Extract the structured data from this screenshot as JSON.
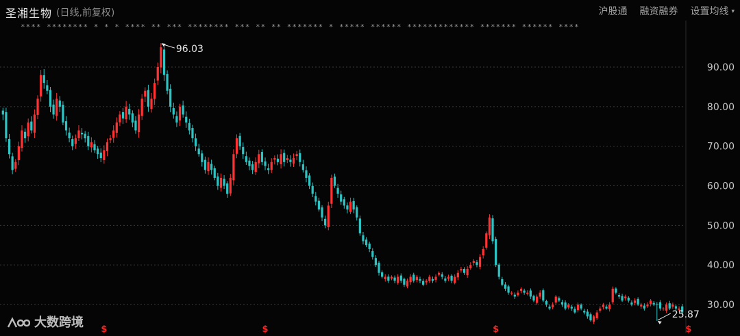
{
  "header": {
    "title": "圣湘生物",
    "subtitle": "(日线,前复权)",
    "menu": [
      "沪股通",
      "融资融券",
      "设置均线"
    ],
    "caret": "▾",
    "ma_row": "**** ******** * * * **** **  *** ******** *** **  ** ******* *  ***** ****** ************* ******* ****** ****"
  },
  "watermark": {
    "text": "大数跨境",
    "logo": "logo-icon"
  },
  "colors": {
    "up": "#ff3333",
    "down": "#2fc4c4",
    "grid": "#3a3a3a",
    "bg": "#050505",
    "text": "#c8c8c8",
    "marker": "#ff2020"
  },
  "chart_data": {
    "type": "candlestick",
    "title": "圣湘生物",
    "ylim": [
      25,
      100
    ],
    "y_ticks": [
      "90.00",
      "80.00",
      "70.00",
      "60.00",
      "50.00",
      "40.00",
      "30.00"
    ],
    "y_tick_values": [
      90,
      80,
      70,
      60,
      50,
      40,
      30
    ],
    "annotations": [
      {
        "label": "96.03",
        "value": 96.03,
        "kind": "high",
        "index": 50
      },
      {
        "label": "25.87",
        "value": 25.87,
        "kind": "low",
        "index": 207
      }
    ],
    "event_markers": [
      "$",
      "$",
      "$",
      "$"
    ],
    "event_marker_indices": [
      32,
      83,
      156,
      217
    ],
    "close": [
      78,
      72,
      68,
      64,
      66,
      70,
      74,
      72,
      76,
      74,
      78,
      82,
      88,
      86,
      84,
      80,
      78,
      82,
      80,
      76,
      74,
      72,
      70,
      72,
      74,
      73,
      72,
      70,
      71,
      69,
      68,
      67,
      69,
      71,
      72,
      74,
      76,
      78,
      77,
      80,
      78,
      76,
      74,
      78,
      82,
      84,
      80,
      82,
      86,
      90,
      95,
      88,
      84,
      80,
      78,
      76,
      80,
      78,
      76,
      74,
      72,
      70,
      68,
      66,
      64,
      66,
      64,
      62,
      60,
      62,
      60,
      58,
      62,
      68,
      72,
      70,
      68,
      66,
      65,
      64,
      66,
      68,
      66,
      65,
      64,
      66,
      67,
      66,
      68,
      66,
      67,
      66,
      67,
      68,
      66,
      64,
      62,
      60,
      58,
      56,
      54,
      52,
      50,
      55,
      62,
      60,
      58,
      56,
      55,
      54,
      56,
      54,
      52,
      48,
      46,
      45,
      44,
      42,
      40,
      38,
      37,
      37,
      36,
      37,
      36,
      37,
      36,
      35,
      36,
      37,
      36,
      37,
      36,
      35,
      36,
      37,
      36,
      37,
      38,
      37,
      36,
      37,
      36,
      37,
      38,
      39,
      38,
      39,
      40,
      41,
      40,
      42,
      44,
      48,
      52,
      46,
      40,
      37,
      35,
      34,
      33,
      33,
      32,
      33,
      34,
      33,
      33,
      32,
      31,
      32,
      33,
      31,
      30,
      29,
      30,
      32,
      31,
      30,
      29,
      30,
      29,
      28,
      30,
      29,
      28,
      27,
      26,
      27,
      28,
      29,
      30,
      29,
      30,
      34,
      33,
      32,
      31,
      32,
      31,
      30,
      31,
      30,
      30,
      29,
      30,
      31,
      30,
      30,
      29,
      29,
      30,
      29,
      30,
      29,
      29,
      28
    ]
  }
}
